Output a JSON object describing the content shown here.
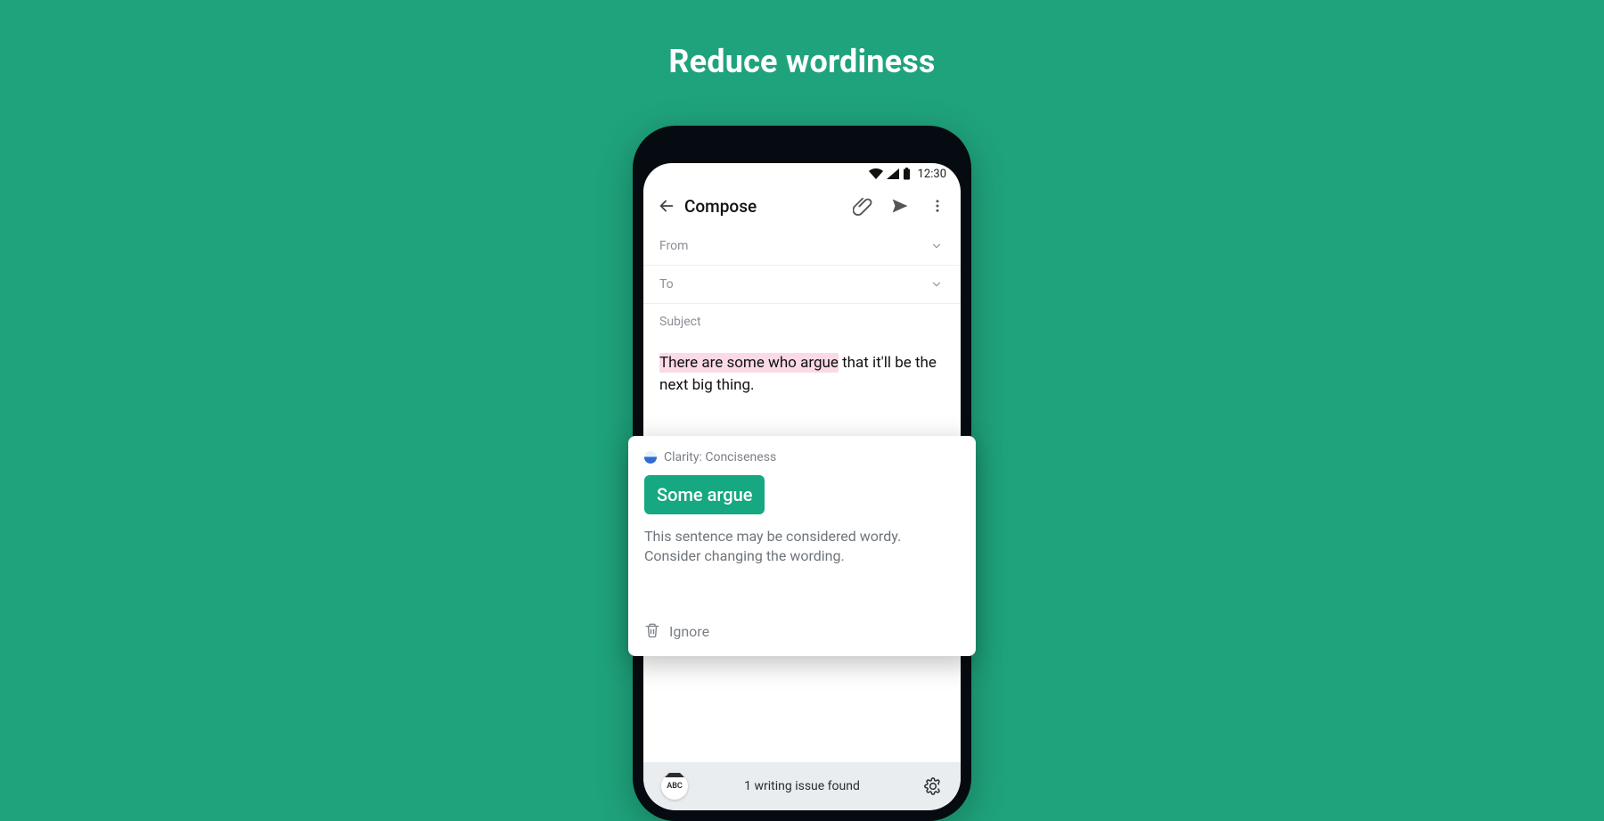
{
  "page": {
    "headline": "Reduce wordiness"
  },
  "status": {
    "time": "12:30"
  },
  "appbar": {
    "title": "Compose"
  },
  "fields": {
    "from": "From",
    "to": "To",
    "subject": "Subject"
  },
  "body": {
    "highlighted": "There are some who argue",
    "rest": " that it'll be the next big thing."
  },
  "card": {
    "tag": "Clarity: Conciseness",
    "suggestion": "Some argue",
    "message_l1": "This sentence may be considered wordy.",
    "message_l2": "Consider changing the wording.",
    "ignore": "Ignore"
  },
  "kb": {
    "abc": "ABC",
    "status_line": "1 writing issue found"
  }
}
